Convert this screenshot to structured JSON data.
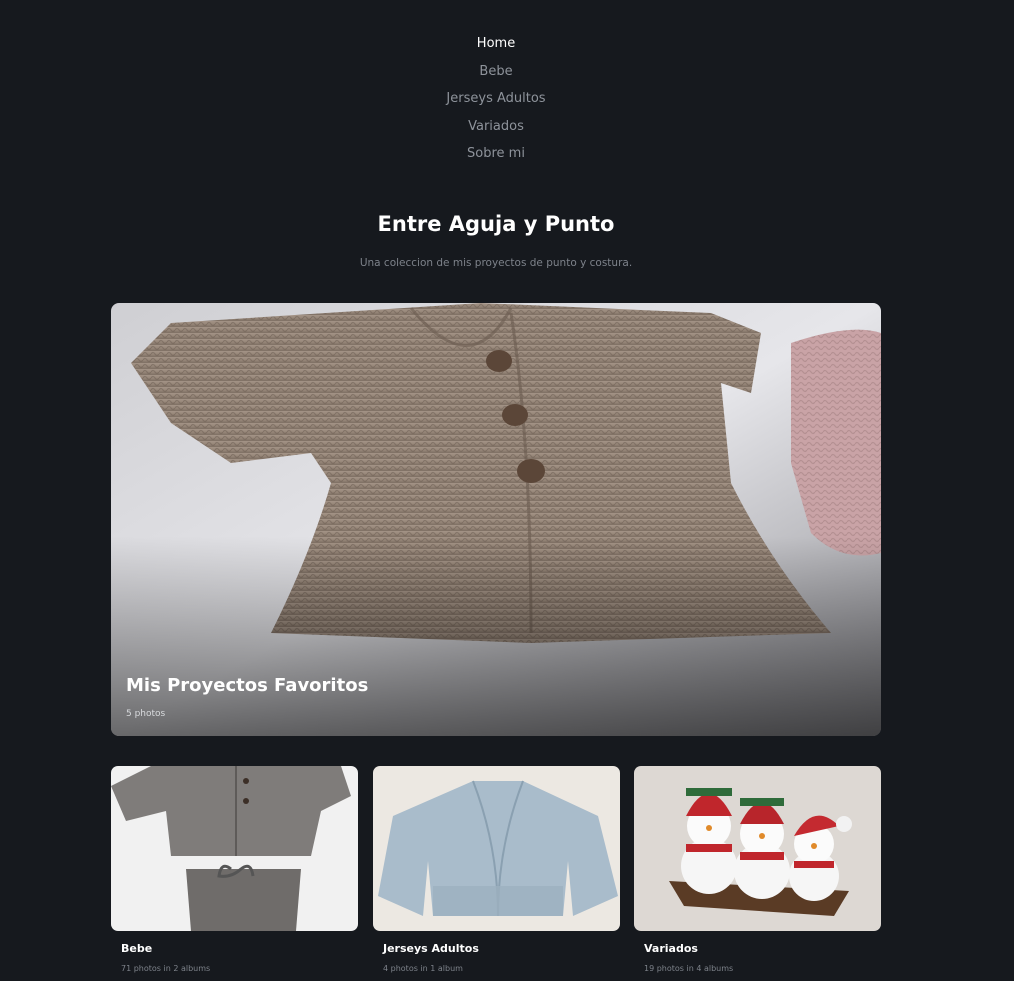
{
  "nav": {
    "items": [
      {
        "label": "Home",
        "active": true
      },
      {
        "label": "Bebe",
        "active": false
      },
      {
        "label": "Jerseys Adultos",
        "active": false
      },
      {
        "label": "Variados",
        "active": false
      },
      {
        "label": "Sobre mi",
        "active": false
      }
    ]
  },
  "header": {
    "title": "Entre Aguja y Punto",
    "tagline": "Una coleccion de mis proyectos de punto y costura."
  },
  "featured": {
    "title": "Mis Proyectos Favoritos",
    "count": "5 photos"
  },
  "albums": [
    {
      "title": "Bebe",
      "count": "71 photos in 2 albums"
    },
    {
      "title": "Jerseys Adultos",
      "count": "4 photos in 1 album"
    },
    {
      "title": "Variados",
      "count": "19 photos in 4 albums"
    }
  ],
  "colors": {
    "background": "#16191e",
    "nav_inactive": "#8e939b",
    "nav_active": "#ffffff",
    "muted_text": "#7d828a"
  }
}
